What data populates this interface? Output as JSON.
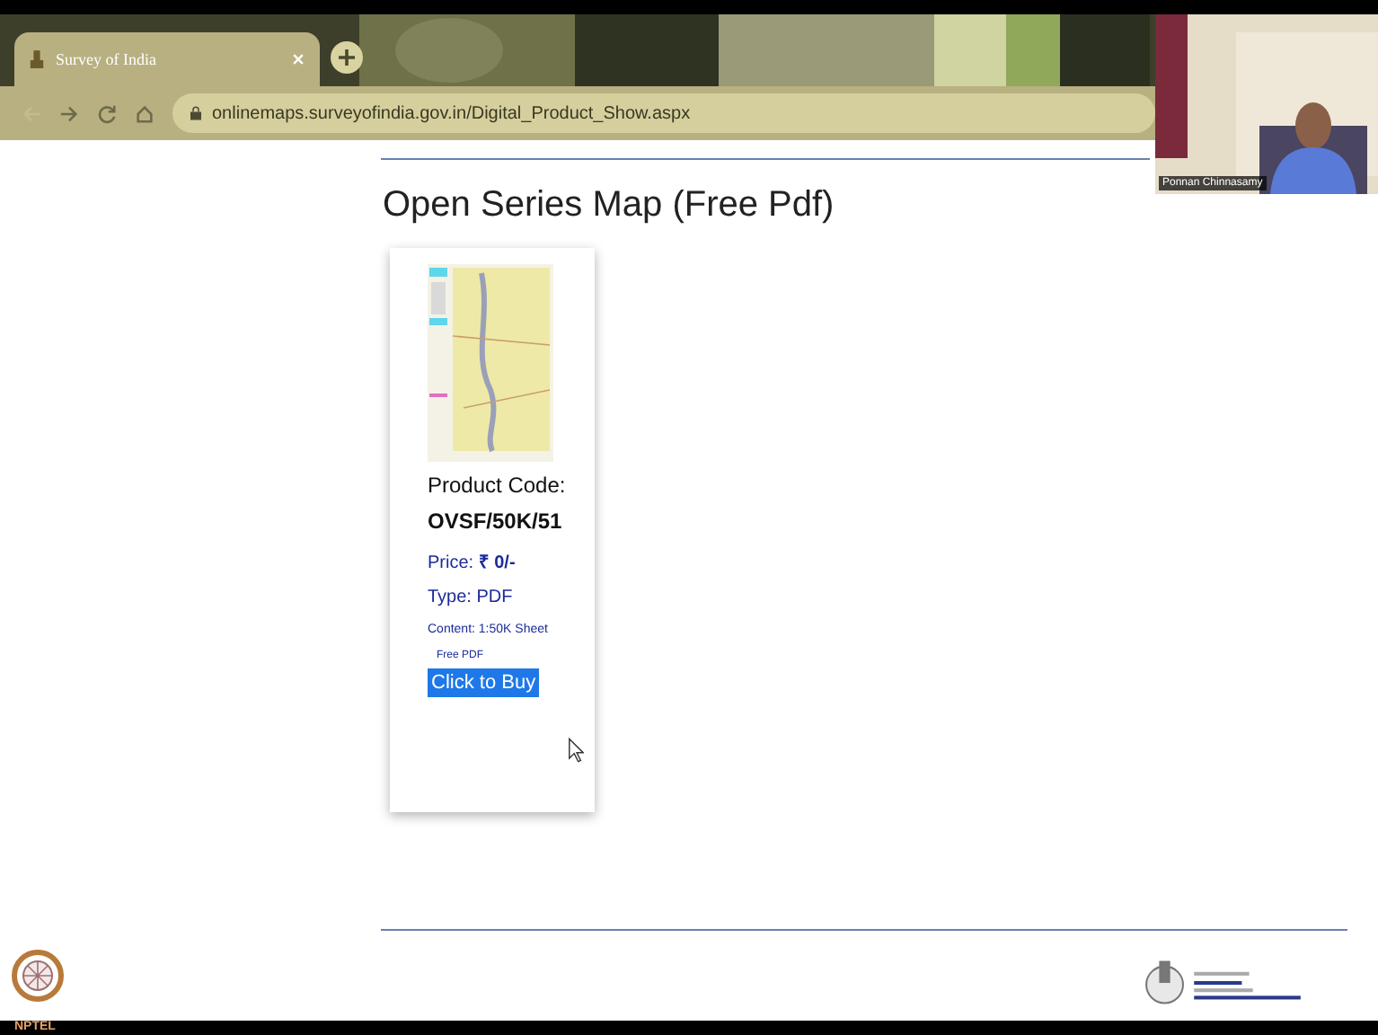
{
  "browser": {
    "tabs": [
      {
        "title": "Survey of India",
        "selected": true
      }
    ],
    "url": "onlinemaps.surveyofindia.gov.in/Digital_Product_Show.aspx"
  },
  "page": {
    "heading": "Open Series Map (Free Pdf)",
    "products": [
      {
        "code_label": "Product Code:",
        "code": "OVSF/50K/51",
        "price": "Price: **₹ 0/-**",
        "type": "Type: PDF",
        "content": "Content: 1:50K Sheet",
        "note": "Free PDF",
        "button": "Click to Buy"
      }
    ]
  },
  "video": {
    "name": "Ponnan Chinnasamy"
  },
  "footer": {
    "logo_text": "NPTEL"
  }
}
